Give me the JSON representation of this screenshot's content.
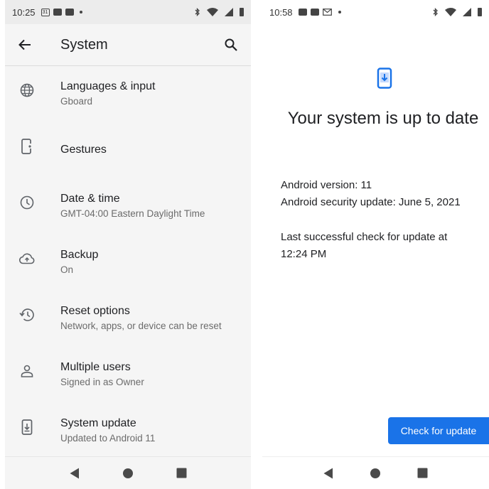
{
  "left_screen": {
    "status_bar": {
      "time": "10:25",
      "calendar_day": "31"
    },
    "app_bar": {
      "title": "System"
    },
    "items": [
      {
        "title": "Languages & input",
        "subtitle": "Gboard",
        "icon": "globe-icon"
      },
      {
        "title": "Gestures",
        "subtitle": "",
        "icon": "gestures-phone-icon"
      },
      {
        "title": "Date & time",
        "subtitle": "GMT-04:00 Eastern Daylight Time",
        "icon": "clock-icon"
      },
      {
        "title": "Backup",
        "subtitle": "On",
        "icon": "cloud-upload-icon"
      },
      {
        "title": "Reset options",
        "subtitle": "Network, apps, or device can be reset",
        "icon": "history-icon"
      },
      {
        "title": "Multiple users",
        "subtitle": "Signed in as Owner",
        "icon": "person-icon"
      },
      {
        "title": "System update",
        "subtitle": "Updated to Android 11",
        "icon": "system-update-icon"
      }
    ]
  },
  "right_screen": {
    "status_bar": {
      "time": "10:58"
    },
    "title": "Your system is up to date",
    "android_version": "Android version: 11",
    "security_update": "Android security update: June 5, 2021",
    "last_check_line1": "Last successful check for update at",
    "last_check_line2": "12:24 PM",
    "check_button": "Check for update",
    "accent_color": "#1a73e8"
  }
}
